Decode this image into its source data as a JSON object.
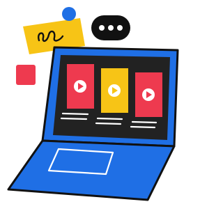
{
  "illustration": {
    "colors": {
      "outline": "#111111",
      "laptop_body": "#1f6fe5",
      "screen": "#222222",
      "card_red": "#ee3a4f",
      "card_yellow": "#f7c416",
      "sticky_note": "#f7c416",
      "chat_bubble": "#111111",
      "blue_dot": "#1f6fe5",
      "red_square": "#ee3a4f",
      "play_button": "#ffffff",
      "text_lines": "#ffffff"
    },
    "icons": [
      "laptop-illustration",
      "sticky-note-scribble",
      "chat-bubble-ellipsis",
      "play-icon"
    ],
    "video_cards": [
      {
        "color": "red",
        "selected": false
      },
      {
        "color": "yellow",
        "selected": true
      },
      {
        "color": "red",
        "selected": false
      }
    ]
  }
}
